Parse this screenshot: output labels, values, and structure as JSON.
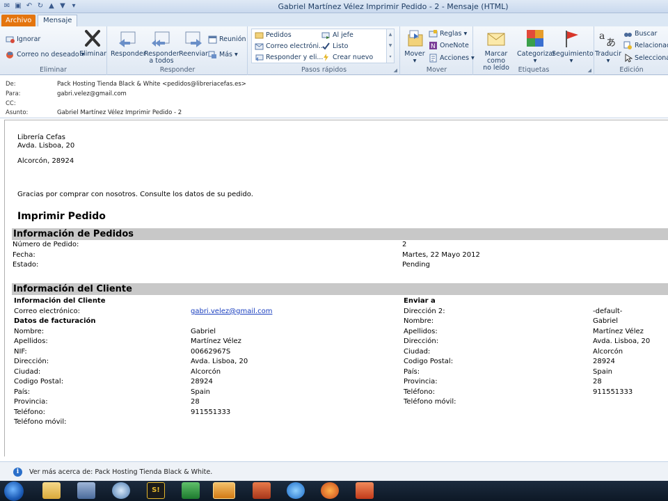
{
  "window": {
    "title": "Gabriel Martínez Vélez Imprimir Pedido - 2  -  Mensaje (HTML)"
  },
  "tabs": {
    "file": "Archivo",
    "message": "Mensaje"
  },
  "ribbon": {
    "eliminar": {
      "ignore": "Ignorar",
      "junk": "Correo no deseado",
      "delete": "Eliminar",
      "label": "Eliminar"
    },
    "responder": {
      "reply": "Responder",
      "reply_all_line1": "Responder",
      "reply_all_line2": "a todos",
      "forward": "Reenviar",
      "meeting": "Reunión",
      "more": "Más",
      "label": "Responder"
    },
    "quick_steps": {
      "items": [
        "Pedidos",
        "Al jefe",
        "Correo electróni...",
        "Listo",
        "Responder y eli...",
        "Crear nuevo"
      ],
      "label": "Pasos rápidos"
    },
    "mover": {
      "move": "Mover",
      "rules": "Reglas",
      "onenote": "OneNote",
      "actions": "Acciones",
      "label": "Mover"
    },
    "etiquetas": {
      "mark_unread_line1": "Marcar como",
      "mark_unread_line2": "no leído",
      "categorize": "Categorizar",
      "followup": "Seguimiento",
      "label": "Etiquetas"
    },
    "edicion": {
      "translate": "Traducir",
      "find": "Buscar",
      "related": "Relacionado",
      "select": "Seleccionar",
      "label": "Edición"
    }
  },
  "headers": {
    "from_label": "De:",
    "from": "Pack Hosting Tienda Black & White <pedidos@libreriacefas.es>",
    "to_label": "Para:",
    "to": "gabri.velez@gmail.com",
    "cc_label": "CC:",
    "subject_label": "Asunto:",
    "subject": "Gabriel Martínez Vélez Imprimir Pedido - 2"
  },
  "message": {
    "store_name": "Librería Cefas",
    "store_address": "Avda. Lisboa, 20",
    "store_city": "Alcorcón, 28924",
    "thanks": "Gracias por comprar con nosotros. Consulte los datos de su pedido.",
    "print_title": "Imprimir Pedido",
    "orders_section": "Información de Pedidos",
    "order_labels": [
      "Número de Pedido:",
      "Fecha:",
      "Estado:"
    ],
    "order_values": [
      "2",
      "Martes, 22 Mayo 2012",
      "Pending"
    ],
    "client_section": "Información del Cliente",
    "client_subheading": "Información del Cliente",
    "email_label": "Correo electrónico:",
    "email_value": "gabri.velez@gmail.com",
    "billing_heading": "Datos de facturación",
    "billing_labels": [
      "Nombre:",
      "Apellidos:",
      "NIF:",
      "Dirección:",
      "Ciudad:",
      "Codigo Postal:",
      "País:",
      "Provincia:",
      "Teléfono:",
      "Teléfono móvil:"
    ],
    "billing_values": [
      "Gabriel",
      "Martínez Vélez",
      "00662967S",
      "Avda. Lisboa, 20",
      "Alcorcón",
      "28924",
      "Spain",
      "28",
      "911551333",
      ""
    ],
    "ship_heading": "Enviar a",
    "ship_labels": [
      "Dirección 2:",
      "Nombre:",
      "Apellidos:",
      "Dirección:",
      "Ciudad:",
      "Codigo Postal:",
      "País:",
      "Provincia:",
      "Teléfono:",
      "Teléfono móvil:"
    ],
    "ship_values": [
      "-default-",
      "Gabriel",
      "Martínez Vélez",
      "Avda. Lisboa, 20",
      "Alcorcón",
      "28924",
      "Spain",
      "28",
      "911551333",
      ""
    ]
  },
  "infobar": {
    "text": "Ver más acerca de: Pack Hosting Tienda Black & White."
  },
  "taskbar": {
    "soft_label": "S!"
  },
  "colors": {
    "file_tab": "#e4750e",
    "section_bar": "#c8c8c8",
    "link": "#1a3fbf"
  }
}
